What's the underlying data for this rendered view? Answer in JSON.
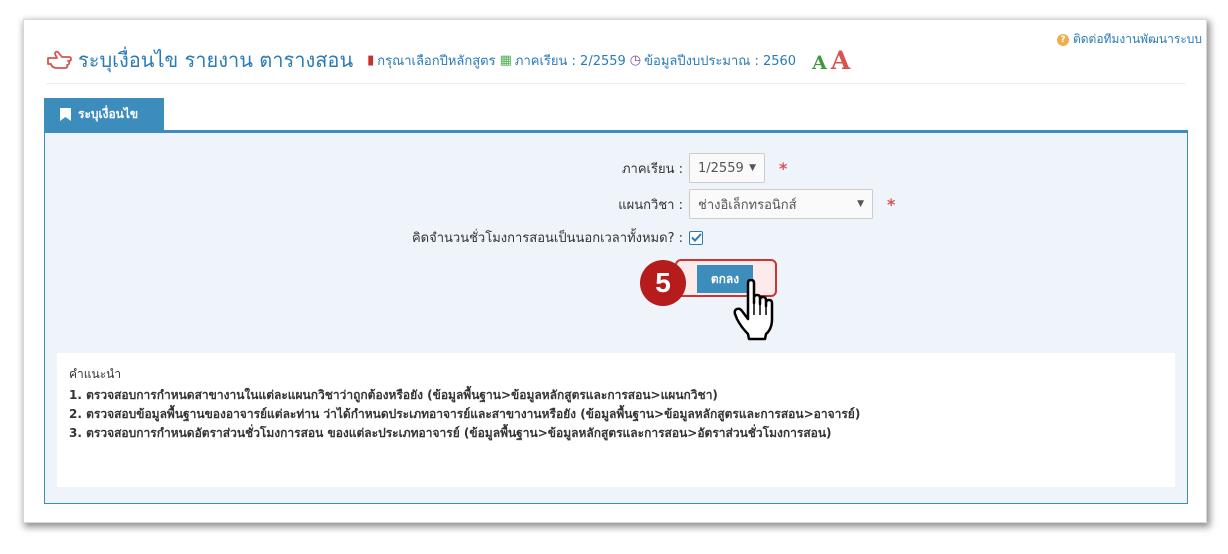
{
  "header": {
    "title": "ระบุเงื่อนไข รายงาน ตารางสอน",
    "curriculum_link": "กรุณาเลือกปีหลักสูตร",
    "semester_text": "ภาคเรียน : 2/2559",
    "budget_text": "ข้อมูลปีงบประมาณ : 2560",
    "font_small": "A",
    "font_large": "A",
    "contact": "ติดต่อทีมงานพัฒนาระบบ"
  },
  "tab": {
    "label": "ระบุเงื่อนไข"
  },
  "form": {
    "semester_label": "ภาคเรียน :",
    "semester_value": "1/2559",
    "department_label": "แผนกวิชา :",
    "department_value": "ช่างอิเล็กทรอนิกส์",
    "overtime_label": "คิดจำนวนชั่วโมงการสอนเป็นนอกเวลาทั้งหมด? :",
    "required_mark": "*",
    "submit_label": "ตกลง",
    "step_number": "5"
  },
  "instructions": {
    "title": "คำแนะนำ",
    "items": [
      "1. ตรวจสอบการกำหนดสาขางานในแต่ละแผนกวิชาว่าถูกต้องหรือยัง (ข้อมูลพื้นฐาน>ข้อมูลหลักสูตรและการสอน>แผนกวิชา)",
      "2. ตรวจสอบข้อมูลพื้นฐานของอาจารย์แต่ละท่าน ว่าได้กำหนดประเภทอาจารย์และสาขางานหรือยัง (ข้อมูลพื้นฐาน>ข้อมูลหลักสูตรและการสอน>อาจารย์)",
      "3. ตรวจสอบการกำหนดอัตราส่วนชั่วโมงการสอน ของแต่ละประเภทอาจารย์ (ข้อมูลพื้นฐาน>ข้อมูลหลักสูตรและการสอน>อัตราส่วนชั่วโมงการสอน)"
    ]
  },
  "colors": {
    "primary": "#3c8dbc",
    "title": "#2a7bb7",
    "required": "#d9534f",
    "badge": "#b71c1c"
  },
  "icons": [
    "hand-point-icon",
    "book-icon",
    "calendar-icon",
    "clock-icon",
    "question-icon",
    "bookmark-icon",
    "check-icon",
    "pointer-hand-icon"
  ]
}
